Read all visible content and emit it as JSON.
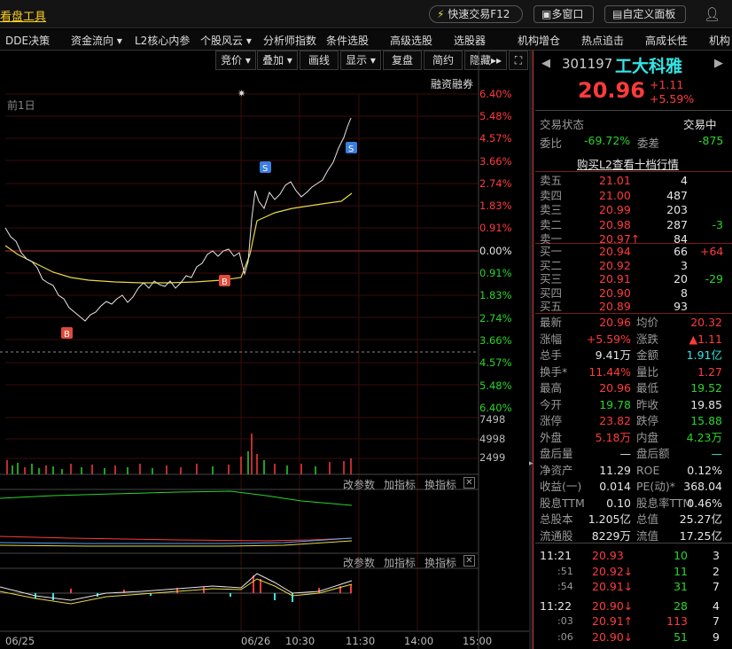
{
  "topbar": {
    "logo": "看盘工具",
    "quick": "快速交易F12",
    "multi": "多窗口",
    "custom": "自定义面板"
  },
  "menu": [
    "DDE决策",
    "资金流向",
    "L2核心内参",
    "个股风云",
    "分析师指数",
    "条件选股",
    "高级选股",
    "选股器",
    "机构增仓",
    "热点追击",
    "高成长性",
    "机构"
  ],
  "toolbar": [
    "竞价",
    "叠加",
    "画线",
    "显示",
    "复盘",
    "简约",
    "隐藏"
  ],
  "chart": {
    "prev_day": "前1日",
    "margin": "融资融券",
    "pct_up": [
      "6.40%",
      "5.48%",
      "4.57%",
      "3.66%",
      "2.74%",
      "1.83%",
      "0.91%",
      "0.00%"
    ],
    "pct_dn": [
      "0.91%",
      "1.83%",
      "2.74%",
      "3.66%",
      "4.57%",
      "5.48%",
      "6.40%"
    ],
    "vol_labels": [
      "7498",
      "4998",
      "2499"
    ],
    "x_labels": [
      "06/25",
      "06/26",
      "10:30",
      "11:30",
      "14:00",
      "15:00"
    ],
    "sub_btns": [
      "改参数",
      "加指标",
      "换指标"
    ],
    "markers": [
      "B",
      "B",
      "S",
      "S"
    ]
  },
  "chart_data": {
    "type": "line",
    "title": "",
    "x_labels": [
      "06/25",
      "06/26",
      "10:30",
      "11:30",
      "14:00",
      "15:00"
    ],
    "ylim": [
      -6.4,
      6.4
    ],
    "prev_close": 19.85,
    "price": [
      0.3,
      -0.5,
      -1.8,
      -3.0,
      -2.5,
      -1.5,
      -0.9,
      -0.5,
      -0.6,
      -0.4,
      -0.3,
      0.0,
      -0.5,
      2.5,
      2.7,
      3.0,
      3.8,
      5.48
    ],
    "avg": [
      0.3,
      -0.8,
      -1.8,
      -2.3,
      -2.4,
      -2.4,
      -2.5,
      -2.6,
      -2.5,
      -2.4,
      -2.2,
      -1.8,
      -0.6,
      0.8,
      1.2,
      1.5,
      1.6,
      2.3
    ]
  },
  "stock": {
    "code": "301197",
    "name": "工大科雅",
    "price": "20.96",
    "chg": "+1.11",
    "pct": "+5.59%"
  },
  "status": {
    "label": "交易状态",
    "value": "交易中",
    "wb_label": "委比",
    "wb": "-69.72%",
    "wc_label": "委差",
    "wc": "-875",
    "l2": "购买L2查看十档行情"
  },
  "sells": [
    {
      "n": "卖五",
      "p": "21.01",
      "v": "4",
      "d": ""
    },
    {
      "n": "卖四",
      "p": "21.00",
      "v": "487",
      "d": ""
    },
    {
      "n": "卖三",
      "p": "20.99",
      "v": "203",
      "d": ""
    },
    {
      "n": "卖二",
      "p": "20.98",
      "v": "287",
      "d": "-3"
    },
    {
      "n": "卖一",
      "p": "20.97",
      "v": "84",
      "d": ""
    }
  ],
  "buys": [
    {
      "n": "买一",
      "p": "20.94",
      "v": "66",
      "d": "+64"
    },
    {
      "n": "买二",
      "p": "20.92",
      "v": "3",
      "d": ""
    },
    {
      "n": "买三",
      "p": "20.91",
      "v": "20",
      "d": "-29"
    },
    {
      "n": "买四",
      "p": "20.90",
      "v": "8",
      "d": ""
    },
    {
      "n": "买五",
      "p": "20.89",
      "v": "93",
      "d": ""
    }
  ],
  "quote": [
    [
      "最新",
      "20.96",
      "均价",
      "20.32"
    ],
    [
      "涨幅",
      "+5.59%",
      "涨跌",
      "▲1.11"
    ],
    [
      "总手",
      "9.41万",
      "金额",
      "1.91亿"
    ],
    [
      "换手*",
      "11.44%",
      "量比",
      "1.27"
    ],
    [
      "最高",
      "20.96",
      "最低",
      "19.52"
    ],
    [
      "今开",
      "19.78",
      "昨收",
      "19.85"
    ],
    [
      "涨停",
      "23.82",
      "跌停",
      "15.88"
    ],
    [
      "外盘",
      "5.18万",
      "内盘",
      "4.23万"
    ],
    [
      "盘后量",
      "—",
      "盘后额",
      "—"
    ],
    [
      "净资产",
      "11.29",
      "ROE",
      "0.12%"
    ],
    [
      "收益(一)",
      "0.014",
      "PE(动)*",
      "368.04"
    ],
    [
      "股息TTM",
      "0.10",
      "股息率TTM",
      "0.46%"
    ],
    [
      "总股本",
      "1.205亿",
      "总值",
      "25.27亿"
    ],
    [
      "流通股",
      "8229万",
      "流值",
      "17.25亿"
    ]
  ],
  "ticks": [
    [
      "11:21",
      "20.93",
      "",
      "10",
      "3"
    ],
    [
      ":51",
      "20.92",
      "↓",
      "11",
      "2"
    ],
    [
      ":54",
      "20.91",
      "↓",
      "31",
      "7"
    ],
    [
      "11:22",
      "20.90",
      "↓",
      "28",
      "4"
    ],
    [
      ":03",
      "20.91",
      "↑",
      "113",
      "7"
    ],
    [
      ":06",
      "20.90",
      "↓",
      "51",
      "9"
    ]
  ]
}
